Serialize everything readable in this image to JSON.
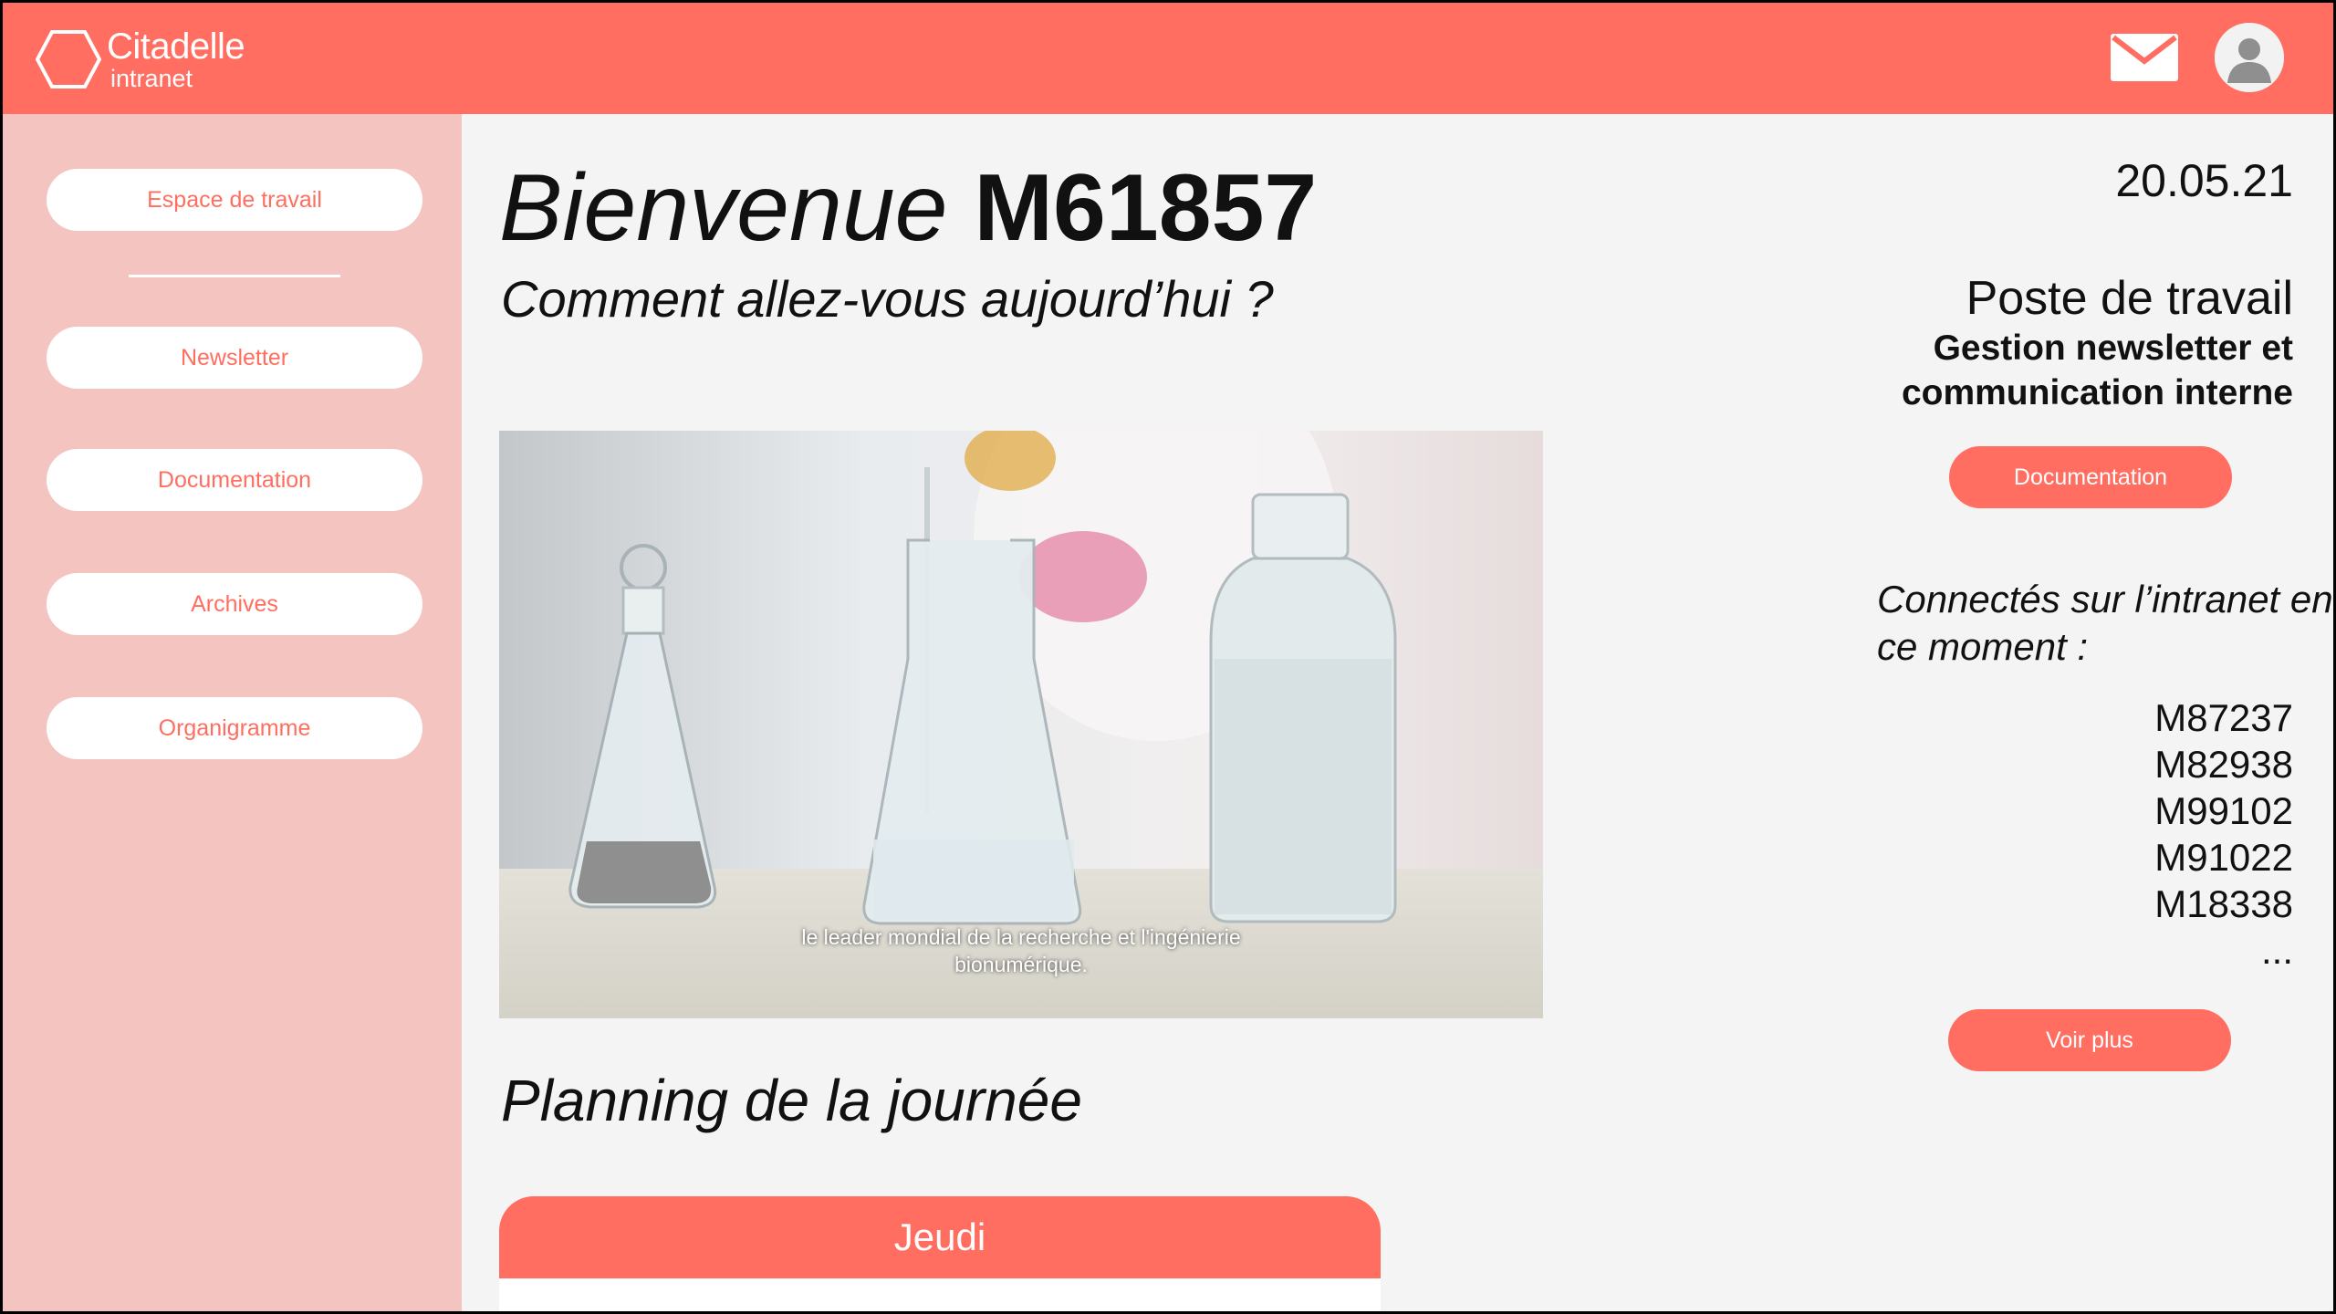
{
  "brand": {
    "name": "Citadelle",
    "sub": "intranet"
  },
  "colors": {
    "accent": "#ff6e60",
    "sidebar": "#f3c4c0",
    "background": "#f4f4f4"
  },
  "header": {
    "icons": [
      "hexagon-logo-icon",
      "mail-icon",
      "user-avatar-icon"
    ]
  },
  "sidebar": {
    "items": [
      {
        "label": "Espace de travail"
      },
      {
        "label": "Newsletter"
      },
      {
        "label": "Documentation"
      },
      {
        "label": "Archives"
      },
      {
        "label": "Organigramme"
      }
    ]
  },
  "main": {
    "welcome_word": "Bienvenue",
    "user_id": "M61857",
    "subtitle": "Comment allez-vous aujourd’hui ?",
    "video": {
      "caption_line1": "le leader mondial de la recherche et l'ingénierie",
      "caption_line2": "bionumérique."
    },
    "planning_title": "Planning de la journée",
    "day": "Jeudi"
  },
  "right": {
    "date": "20.05.21",
    "post_title": "Poste de travail",
    "post_value": "Gestion newsletter et communication interne",
    "doc_button": "Documentation",
    "connected_label": "Connectés sur l’intranet en ce moment :",
    "connected_users": [
      "M87237",
      "M82938",
      "M99102",
      "M91022",
      "M18338",
      "..."
    ],
    "more_button": "Voir plus"
  }
}
